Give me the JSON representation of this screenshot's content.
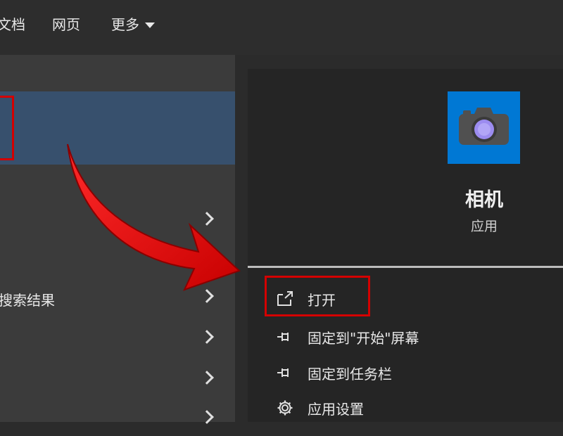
{
  "top_tabs": [
    {
      "label": "文档"
    },
    {
      "label": "网页"
    },
    {
      "label": "更多"
    }
  ],
  "left_list": [
    {
      "label": ""
    },
    {
      "label": "搜索结果"
    },
    {
      "label": ""
    },
    {
      "label": ""
    },
    {
      "label": ""
    }
  ],
  "app": {
    "name": "相机",
    "type": "应用",
    "icon": "camera-icon",
    "icon_bg": "#0078d4"
  },
  "actions": [
    {
      "label": "打开",
      "icon": "open-external-icon"
    },
    {
      "label": "固定到\"开始\"屏幕",
      "icon": "pin-icon"
    },
    {
      "label": "固定到任务栏",
      "icon": "pin-icon"
    },
    {
      "label": "应用设置",
      "icon": "gear-icon"
    }
  ],
  "colors": {
    "highlight": "#37506d",
    "annotation_red": "#d40000"
  }
}
